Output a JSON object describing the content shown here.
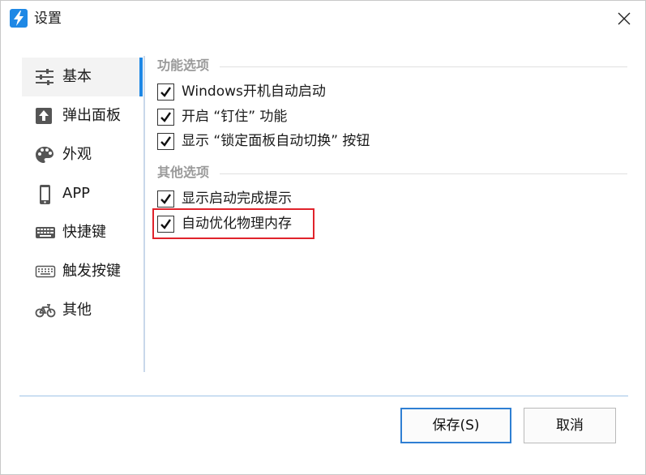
{
  "window": {
    "title": "设置",
    "app_icon": "bolt-icon",
    "close_icon": "close-icon"
  },
  "sidebar": {
    "items": [
      {
        "label": "基本",
        "icon": "sliders-icon",
        "active": true
      },
      {
        "label": "弹出面板",
        "icon": "upload-arrow-icon"
      },
      {
        "label": "外观",
        "icon": "palette-icon"
      },
      {
        "label": "APP",
        "icon": "phone-icon"
      },
      {
        "label": "快捷键",
        "icon": "keyboard-icon"
      },
      {
        "label": "触发按键",
        "icon": "keyboard-outline-icon"
      },
      {
        "label": "其他",
        "icon": "bicycle-icon"
      }
    ]
  },
  "content": {
    "sections": [
      {
        "title": "功能选项",
        "options": [
          {
            "label": "Windows开机自动启动",
            "checked": true
          },
          {
            "label": "开启 “钉住” 功能",
            "checked": true
          },
          {
            "label": "显示 “锁定面板自动切换” 按钮",
            "checked": true
          }
        ]
      },
      {
        "title": "其他选项",
        "options": [
          {
            "label": "显示启动完成提示",
            "checked": true
          },
          {
            "label": "自动优化物理内存",
            "checked": true,
            "highlighted": true
          }
        ]
      }
    ]
  },
  "footer": {
    "save_label": "保存(S)",
    "cancel_label": "取消"
  },
  "colors": {
    "accent": "#1e88e5",
    "highlight": "#e0232b",
    "section_title": "#9a9a9a"
  }
}
